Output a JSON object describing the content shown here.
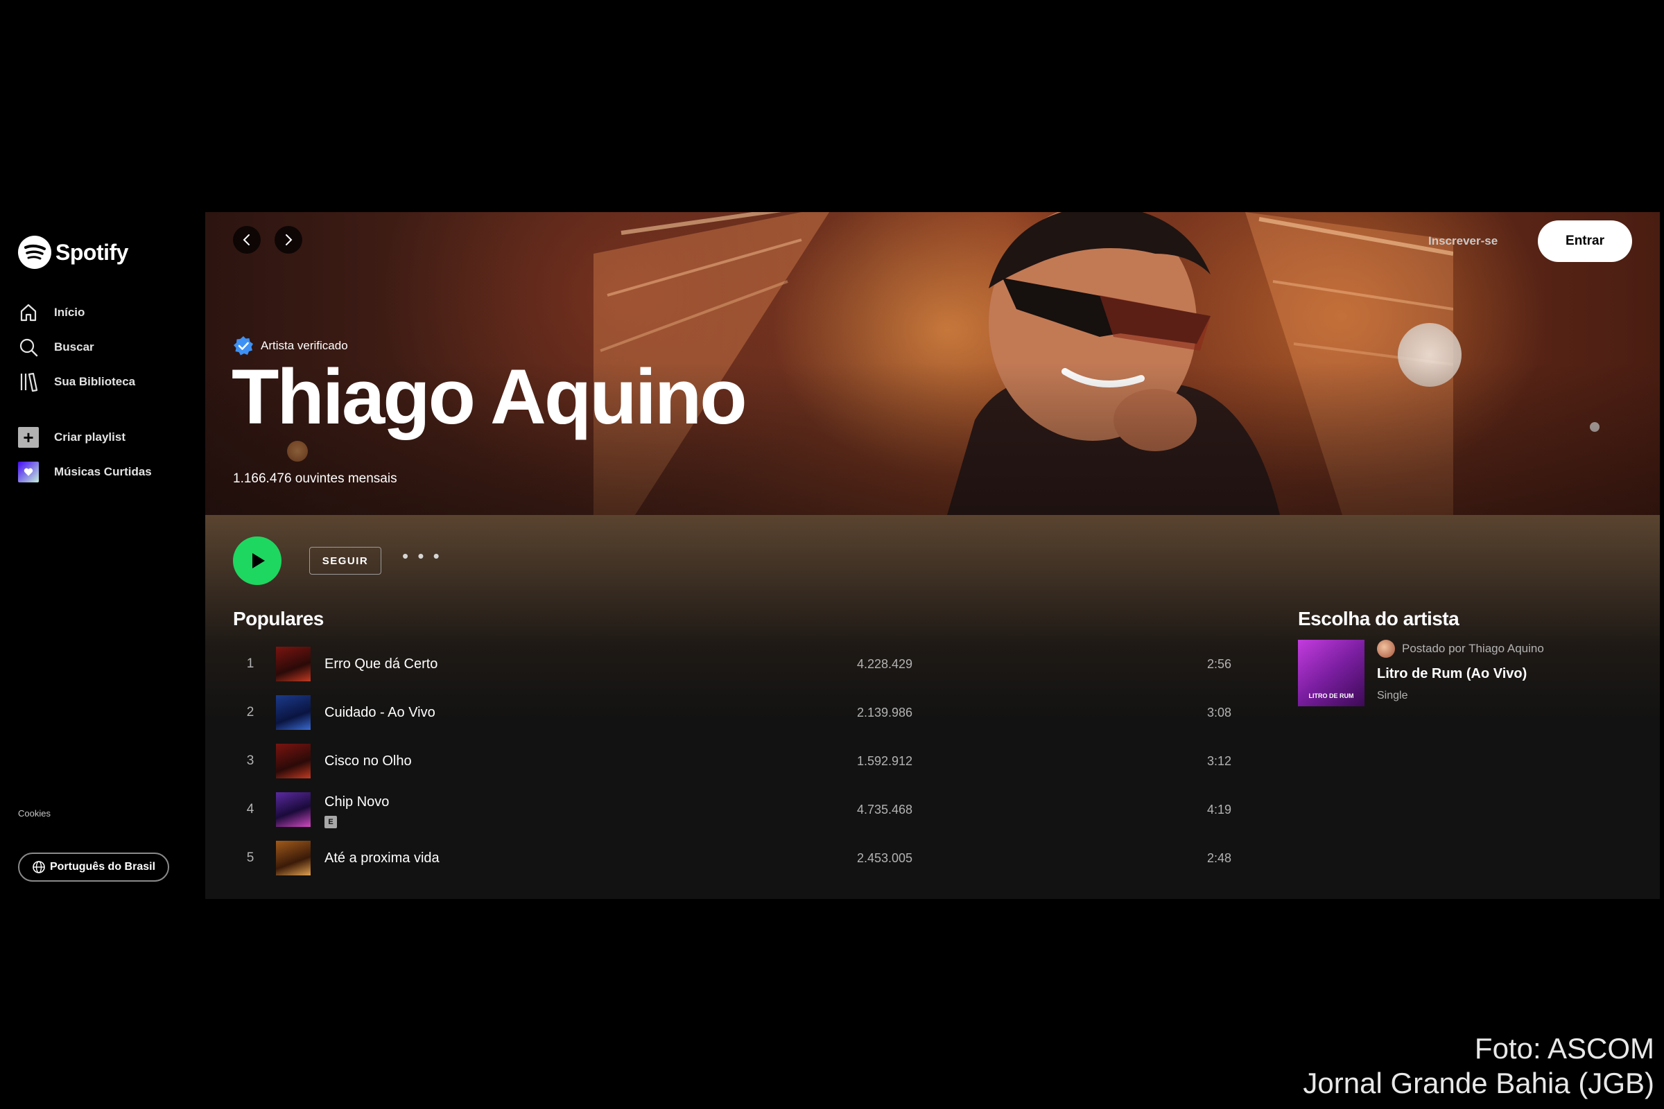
{
  "brand": {
    "name": "Spotify"
  },
  "sidebar": {
    "nav": [
      {
        "label": "Início",
        "icon": "home-icon"
      },
      {
        "label": "Buscar",
        "icon": "search-icon"
      },
      {
        "label": "Sua Biblioteca",
        "icon": "library-icon"
      }
    ],
    "actions": [
      {
        "label": "Criar playlist",
        "icon": "plus-icon"
      },
      {
        "label": "Músicas Curtidas",
        "icon": "heart-icon"
      }
    ],
    "cookies": "Cookies",
    "language": "Português do Brasil"
  },
  "header": {
    "signup": "Inscrever-se",
    "login": "Entrar"
  },
  "artist": {
    "verified_label": "Artista verificado",
    "name": "Thiago Aquino",
    "monthly_listeners": "1.166.476 ouvintes mensais"
  },
  "controls": {
    "follow": "SEGUIR",
    "more": "• • •"
  },
  "popular": {
    "title": "Populares",
    "tracks": [
      {
        "num": "1",
        "title": "Erro Que dá Certo",
        "plays": "4.228.429",
        "duration": "2:56",
        "explicit": false
      },
      {
        "num": "2",
        "title": "Cuidado - Ao Vivo",
        "plays": "2.139.986",
        "duration": "3:08",
        "explicit": false
      },
      {
        "num": "3",
        "title": "Cisco no Olho",
        "plays": "1.592.912",
        "duration": "3:12",
        "explicit": false
      },
      {
        "num": "4",
        "title": "Chip Novo",
        "plays": "4.735.468",
        "duration": "4:19",
        "explicit": true,
        "explicit_label": "E"
      },
      {
        "num": "5",
        "title": "Até a proxima vida",
        "plays": "2.453.005",
        "duration": "2:48",
        "explicit": false
      }
    ]
  },
  "artist_pick": {
    "title": "Escolha do artista",
    "posted_by": "Postado por Thiago Aquino",
    "song": "Litro de Rum (Ao Vivo)",
    "type": "Single",
    "cover_text": "LITRO DE RUM"
  },
  "credit": {
    "line1": "Foto: ASCOM",
    "line2": "Jornal Grande Bahia (JGB)"
  },
  "colors": {
    "accent_green": "#1ed760",
    "background": "#121212",
    "verified_blue": "#3d91f4"
  }
}
